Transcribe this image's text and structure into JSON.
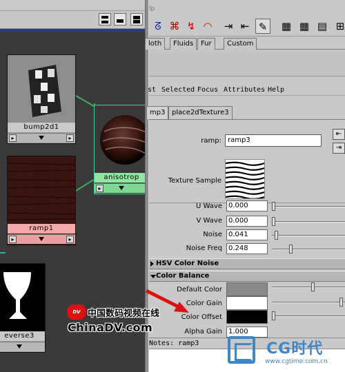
{
  "window": {
    "title_fragment": "lp"
  },
  "shelf": {
    "icons": [
      "curve-icon",
      "magnet-icon",
      "magnet-red-icon",
      "lasso-icon",
      "insert-key-icon",
      "remove-key-icon",
      "render-icon",
      "clapper-icon",
      "clapper-ipr-icon",
      "clapper-batch-icon",
      "ruler-icon"
    ],
    "tabs": [
      "loth",
      "Fluids",
      "Fur",
      "Custom"
    ]
  },
  "attribute_editor": {
    "menu": [
      "st",
      "Selected",
      "Focus",
      "Attributes",
      "Help"
    ],
    "tabs": [
      "mp3",
      "place2dTexture3"
    ],
    "ramp_label": "ramp:",
    "ramp_value": "ramp3",
    "texture_sample_label": "Texture Sample",
    "rows": [
      {
        "label": "U Wave",
        "value": "0.000",
        "slider": 0.0
      },
      {
        "label": "V Wave",
        "value": "0.000",
        "slider": 0.0
      },
      {
        "label": "Noise",
        "value": "0.041",
        "slider": 0.04
      },
      {
        "label": "Noise Freq",
        "value": "0.248",
        "slider": 0.25
      }
    ],
    "sections": {
      "hsv": "HSV Color Noise",
      "balance": "Color Balance"
    },
    "color_rows": [
      {
        "label": "Default Color",
        "color": "#8a8a8a",
        "slider": 0.58
      },
      {
        "label": "Color Gain",
        "color": "#ffffff",
        "slider": 1.0
      },
      {
        "label": "Color Offset",
        "color": "#000000",
        "slider": 0.0
      }
    ],
    "alpha_gain": {
      "label": "Alpha Gain",
      "value": "1.000"
    },
    "notes_label": "Notes:  ramp3"
  },
  "hypershade": {
    "nodes": [
      {
        "label": "bump2d1"
      },
      {
        "label": "anisotrop"
      },
      {
        "label": "ramp1"
      },
      {
        "label": "everse3"
      }
    ]
  },
  "watermarks": {
    "cn_logo": "DV",
    "cn_text": "中国数码视频在线",
    "chinadv": "ChinaDV.com",
    "cg_text": "CG时代",
    "cg_url": "www.cgtime.com.cn"
  },
  "colors": {
    "connection": "#3fae5a",
    "graph_bg": "#3a3a3a",
    "accent_red": "#e01010",
    "ramp_bg": "#3a1410",
    "ramp_node": "#f4a9a9",
    "aniso_node": "#8fe79f"
  }
}
